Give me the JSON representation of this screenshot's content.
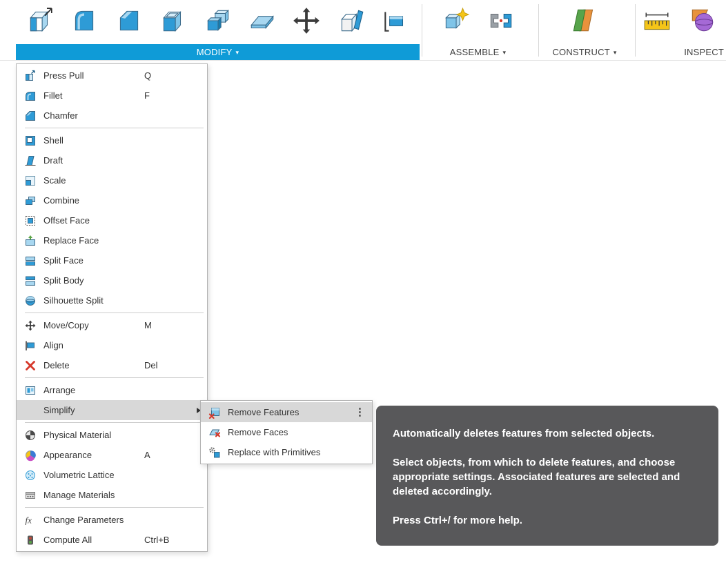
{
  "toolbar": {
    "groups": [
      {
        "name": "modify",
        "tab": {
          "label": "MODIFY",
          "has_caret": true,
          "active": true
        },
        "icons": [
          "press-pull",
          "fillet",
          "chamfer",
          "shell",
          "combine",
          "split-body",
          "move-copy",
          "draft",
          "align"
        ]
      },
      {
        "name": "assemble",
        "tab": {
          "label": "ASSEMBLE",
          "has_caret": true,
          "active": false
        },
        "icons": [
          "new-component",
          "joint"
        ]
      },
      {
        "name": "construct",
        "tab": {
          "label": "CONSTRUCT",
          "has_caret": true,
          "active": false
        },
        "icons": [
          "construct-plane"
        ]
      },
      {
        "name": "inspect",
        "tab": {
          "label": "INSPECT",
          "has_caret": false,
          "active": false
        },
        "icons": [
          "measure",
          "section-analysis"
        ]
      }
    ]
  },
  "modify_menu": {
    "items": [
      {
        "label": "Press Pull",
        "shortcut": "Q",
        "icon": "press-pull"
      },
      {
        "label": "Fillet",
        "shortcut": "F",
        "icon": "fillet"
      },
      {
        "label": "Chamfer",
        "icon": "chamfer",
        "separator_after": true
      },
      {
        "label": "Shell",
        "icon": "shell"
      },
      {
        "label": "Draft",
        "icon": "draft"
      },
      {
        "label": "Scale",
        "icon": "scale"
      },
      {
        "label": "Combine",
        "icon": "combine"
      },
      {
        "label": "Offset Face",
        "icon": "offset-face"
      },
      {
        "label": "Replace Face",
        "icon": "replace-face"
      },
      {
        "label": "Split Face",
        "icon": "split-face"
      },
      {
        "label": "Split Body",
        "icon": "split-body"
      },
      {
        "label": "Silhouette Split",
        "icon": "silhouette-split",
        "separator_after": true
      },
      {
        "label": "Move/Copy",
        "shortcut": "M",
        "icon": "move-copy"
      },
      {
        "label": "Align",
        "icon": "align"
      },
      {
        "label": "Delete",
        "shortcut": "Del",
        "icon": "delete",
        "separator_after": true
      },
      {
        "label": "Arrange",
        "icon": "arrange"
      },
      {
        "label": "Simplify",
        "submenu": true,
        "highlighted": true,
        "separator_after": true
      },
      {
        "label": "Physical Material",
        "icon": "physical-material"
      },
      {
        "label": "Appearance",
        "shortcut": "A",
        "icon": "appearance"
      },
      {
        "label": "Volumetric Lattice",
        "icon": "volumetric-lattice"
      },
      {
        "label": "Manage Materials",
        "icon": "manage-materials",
        "separator_after": true
      },
      {
        "label": "Change Parameters",
        "icon": "change-parameters"
      },
      {
        "label": "Compute All",
        "shortcut": "Ctrl+B",
        "icon": "compute-all"
      }
    ]
  },
  "simplify_submenu": {
    "items": [
      {
        "label": "Remove Features",
        "icon": "remove-features",
        "highlighted": true,
        "has_more": true
      },
      {
        "label": "Remove Faces",
        "icon": "remove-faces"
      },
      {
        "label": "Replace with Primitives",
        "icon": "replace-with-primitives"
      }
    ]
  },
  "tooltip": {
    "paragraphs": [
      "Automatically deletes features from selected objects.",
      "Select objects, from which to delete features, and choose appropriate settings. Associated features are selected and deleted accordingly.",
      "Press Ctrl+/ for more help."
    ]
  },
  "colors": {
    "accent_blue": "#0f9bd7",
    "highlight_gray": "#d8d8d8",
    "tooltip_bg": "#58585a"
  }
}
